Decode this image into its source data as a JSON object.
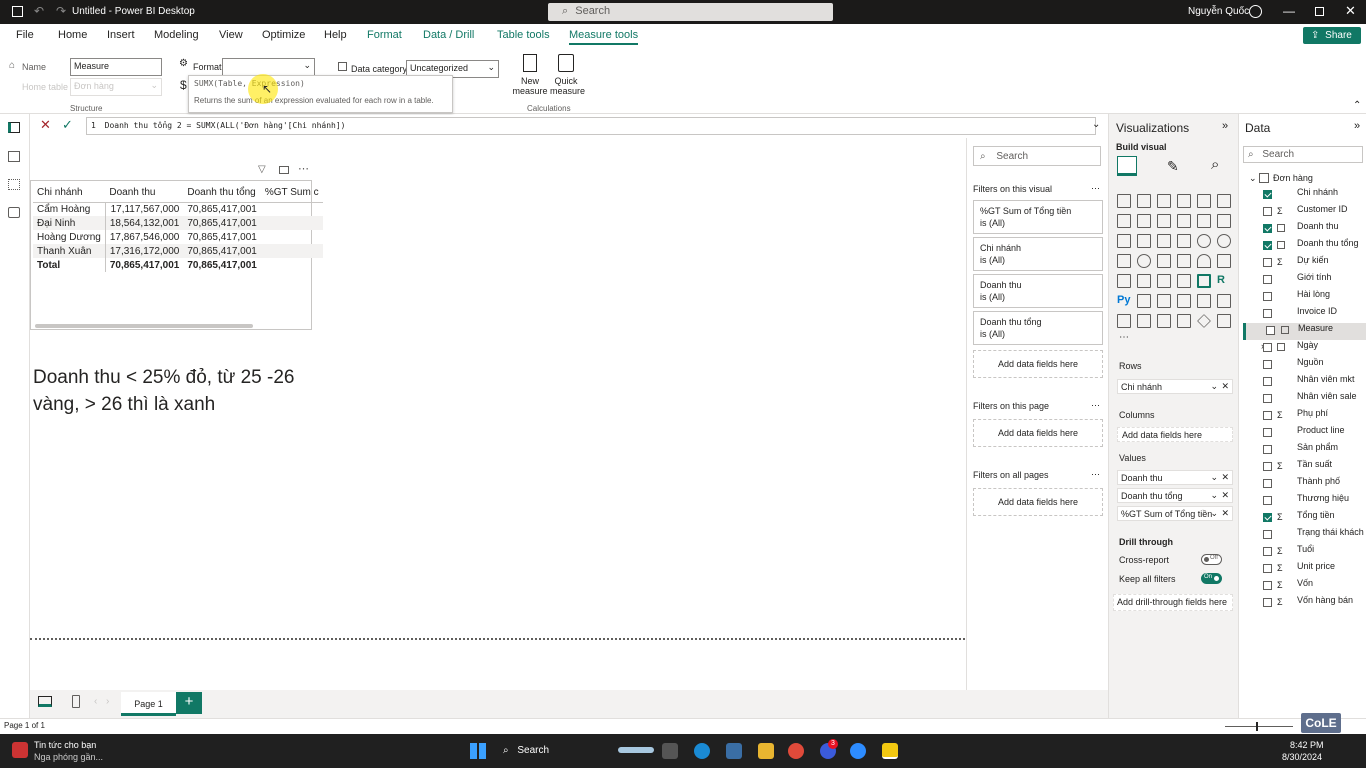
{
  "titlebar": {
    "title": "Untitled - Power BI Desktop",
    "search": "Search",
    "user": "Nguyễn Quốc"
  },
  "tabs": [
    "File",
    "Home",
    "Insert",
    "Modeling",
    "View",
    "Optimize",
    "Help",
    "Format",
    "Data / Drill",
    "Table tools",
    "Measure tools"
  ],
  "share": "Share",
  "ribbon": {
    "name_label": "Name",
    "name_value": "Measure",
    "home_table_label": "Home table",
    "home_table_value": "Đơn hàng",
    "structure": "Structure",
    "format_label": "Format",
    "data_category_label": "Data category",
    "data_category_value": "Uncategorized",
    "new_measure": [
      "New",
      "measure"
    ],
    "quick_measure": [
      "Quick",
      "measure"
    ],
    "calculations": "Calculations",
    "tooltip_sig": "SUMX(Table, Expression)",
    "tooltip_desc": "Returns the sum of an expression evaluated for each row in a table."
  },
  "formula": {
    "line": "1",
    "text": "Doanh thu tổng 2 = SUMX(ALL('Đơn hàng'[Chi nhánh])"
  },
  "table": {
    "headers": [
      "Chi nhánh",
      "Doanh thu",
      "Doanh thu tổng",
      "%GT Sum c"
    ],
    "rows": [
      [
        "Cẩm Hoàng",
        "17,117,567,000",
        "70,865,417,001"
      ],
      [
        "Đại Ninh",
        "18,564,132,001",
        "70,865,417,001"
      ],
      [
        "Hoàng Dương",
        "17,867,546,000",
        "70,865,417,001"
      ],
      [
        "Thanh Xuân",
        "17,316,172,000",
        "70,865,417,001"
      ]
    ],
    "total": [
      "Total",
      "70,865,417,001",
      "70,865,417,001"
    ]
  },
  "note": [
    "Doanh thu < 25% đỏ, từ 25 -26",
    "vàng, > 26 thì là xanh"
  ],
  "filters": {
    "search": "Search",
    "on_visual": "Filters on this visual",
    "cards": [
      {
        "name": "%GT Sum of Tổng tiền",
        "val": "is (All)"
      },
      {
        "name": "Chi nhánh",
        "val": "is (All)"
      },
      {
        "name": "Doanh thu",
        "val": "is (All)"
      },
      {
        "name": "Doanh thu tổng",
        "val": "is (All)"
      }
    ],
    "add": "Add data fields here",
    "on_page": "Filters on this page",
    "on_all": "Filters on all pages"
  },
  "viz": {
    "title": "Visualizations",
    "build": "Build visual",
    "rows": "Rows",
    "rows_field": "Chi nhánh",
    "columns": "Columns",
    "add": "Add data fields here",
    "values": "Values",
    "values_fields": [
      "Doanh thu",
      "Doanh thu tổng",
      "%GT Sum of Tổng tiền"
    ],
    "drill": "Drill through",
    "cross": "Cross-report",
    "cross_state": "Off",
    "keep": "Keep all filters",
    "keep_state": "On",
    "add_drill": "Add drill-through fields here"
  },
  "data": {
    "title": "Data",
    "search": "Search",
    "table": "Đơn hàng",
    "fields": [
      {
        "name": "Chi nhánh",
        "checked": true,
        "sigma": false
      },
      {
        "name": "Customer ID",
        "checked": false,
        "sigma": true
      },
      {
        "name": "Doanh thu",
        "checked": true,
        "sigma": false
      },
      {
        "name": "Doanh thu tổng",
        "checked": true,
        "sigma": false
      },
      {
        "name": "Dự kiến",
        "checked": false,
        "sigma": true
      },
      {
        "name": "Giới tính",
        "checked": false,
        "sigma": false
      },
      {
        "name": "Hài lòng",
        "checked": false,
        "sigma": false
      },
      {
        "name": "Invoice ID",
        "checked": false,
        "sigma": false
      },
      {
        "name": "Measure",
        "checked": false,
        "sigma": false
      },
      {
        "name": "Ngày",
        "checked": false,
        "sigma": false
      },
      {
        "name": "Nguồn",
        "checked": false,
        "sigma": false
      },
      {
        "name": "Nhân viên mkt",
        "checked": false,
        "sigma": false
      },
      {
        "name": "Nhân viên sale",
        "checked": false,
        "sigma": false
      },
      {
        "name": "Phụ phí",
        "checked": false,
        "sigma": true
      },
      {
        "name": "Product line",
        "checked": false,
        "sigma": false
      },
      {
        "name": "Sản phẩm",
        "checked": false,
        "sigma": false
      },
      {
        "name": "Tần suất",
        "checked": false,
        "sigma": true
      },
      {
        "name": "Thành phố",
        "checked": false,
        "sigma": false
      },
      {
        "name": "Thương hiệu",
        "checked": false,
        "sigma": false
      },
      {
        "name": "Tổng tiền",
        "checked": true,
        "sigma": true
      },
      {
        "name": "Trạng thái khách",
        "checked": false,
        "sigma": false
      },
      {
        "name": "Tuổi",
        "checked": false,
        "sigma": true
      },
      {
        "name": "Unit price",
        "checked": false,
        "sigma": true
      },
      {
        "name": "Vốn",
        "checked": false,
        "sigma": true
      },
      {
        "name": "Vốn hàng bán",
        "checked": false,
        "sigma": true
      }
    ]
  },
  "pages": {
    "page1": "Page 1",
    "status": "Page 1 of 1"
  },
  "taskbar": {
    "news1": "Tin tức cho bạn",
    "news2": "Nga phóng gần...",
    "search": "Search",
    "time": "8:42 PM",
    "date": "8/30/2024",
    "badge": "3",
    "watermark": "CoLE"
  },
  "colors": {
    "accent": "#117865",
    "titlebar": "#1b1a19",
    "taskbar": "#202020"
  }
}
